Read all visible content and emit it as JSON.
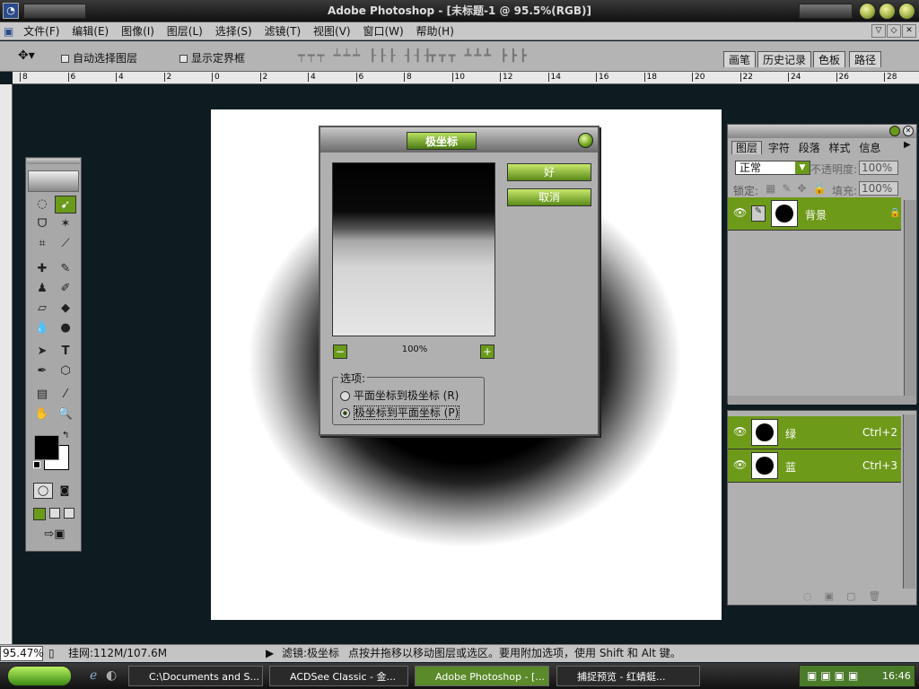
{
  "window": {
    "title": "Adobe Photoshop - [未标题-1 @ 95.5%(RGB)]"
  },
  "menu": [
    "文件(F)",
    "编辑(E)",
    "图像(I)",
    "图层(L)",
    "选择(S)",
    "滤镜(T)",
    "视图(V)",
    "窗口(W)",
    "帮助(H)"
  ],
  "options": {
    "auto_select": "自动选择图层",
    "show_bounds": "显示定界框"
  },
  "palette_tabs": [
    "画笔",
    "历史记录",
    "色板",
    "路径"
  ],
  "ruler_ticks": [
    "8",
    "6",
    "4",
    "2",
    "0",
    "2",
    "4",
    "6",
    "8",
    "10",
    "12",
    "14",
    "16",
    "18",
    "20",
    "22",
    "24",
    "26",
    "28"
  ],
  "dialog": {
    "title": "极坐标",
    "ok": "好",
    "cancel": "取消",
    "zoom": "100%",
    "options_label": "选项:",
    "option_rect_to_polar": "平面坐标到极坐标 (R)",
    "option_polar_to_rect": "极坐标到平面坐标 (P)",
    "selected_option": "polar_to_rect"
  },
  "layers_panel": {
    "tabs": [
      "图层",
      "字符",
      "段落",
      "样式",
      "信息"
    ],
    "blend_mode": "正常",
    "opacity_label": "不透明度:",
    "opacity": "100%",
    "lock_label": "锁定:",
    "fill_label": "填充:",
    "fill": "100%",
    "layers": [
      {
        "name": "背景"
      }
    ]
  },
  "channels_panel": {
    "channels": [
      {
        "name": "绿",
        "shortcut": "Ctrl+2"
      },
      {
        "name": "蓝",
        "shortcut": "Ctrl+3"
      }
    ]
  },
  "status": {
    "zoom": "95.47%",
    "doc": "挂网:112M/107.6M",
    "tool": "滤镜:极坐标",
    "hint": "点按并拖移以移动图层或选区。要用附加选项，使用 Shift 和 Alt 键。"
  },
  "taskbar": {
    "tasks": [
      "C:\\Documents and S...",
      "ACDSee Classic - 金...",
      "Adobe Photoshop - [...",
      "捕捉预览 - 红蜻蜓..."
    ],
    "active_index": 2,
    "clock": "16:46"
  }
}
